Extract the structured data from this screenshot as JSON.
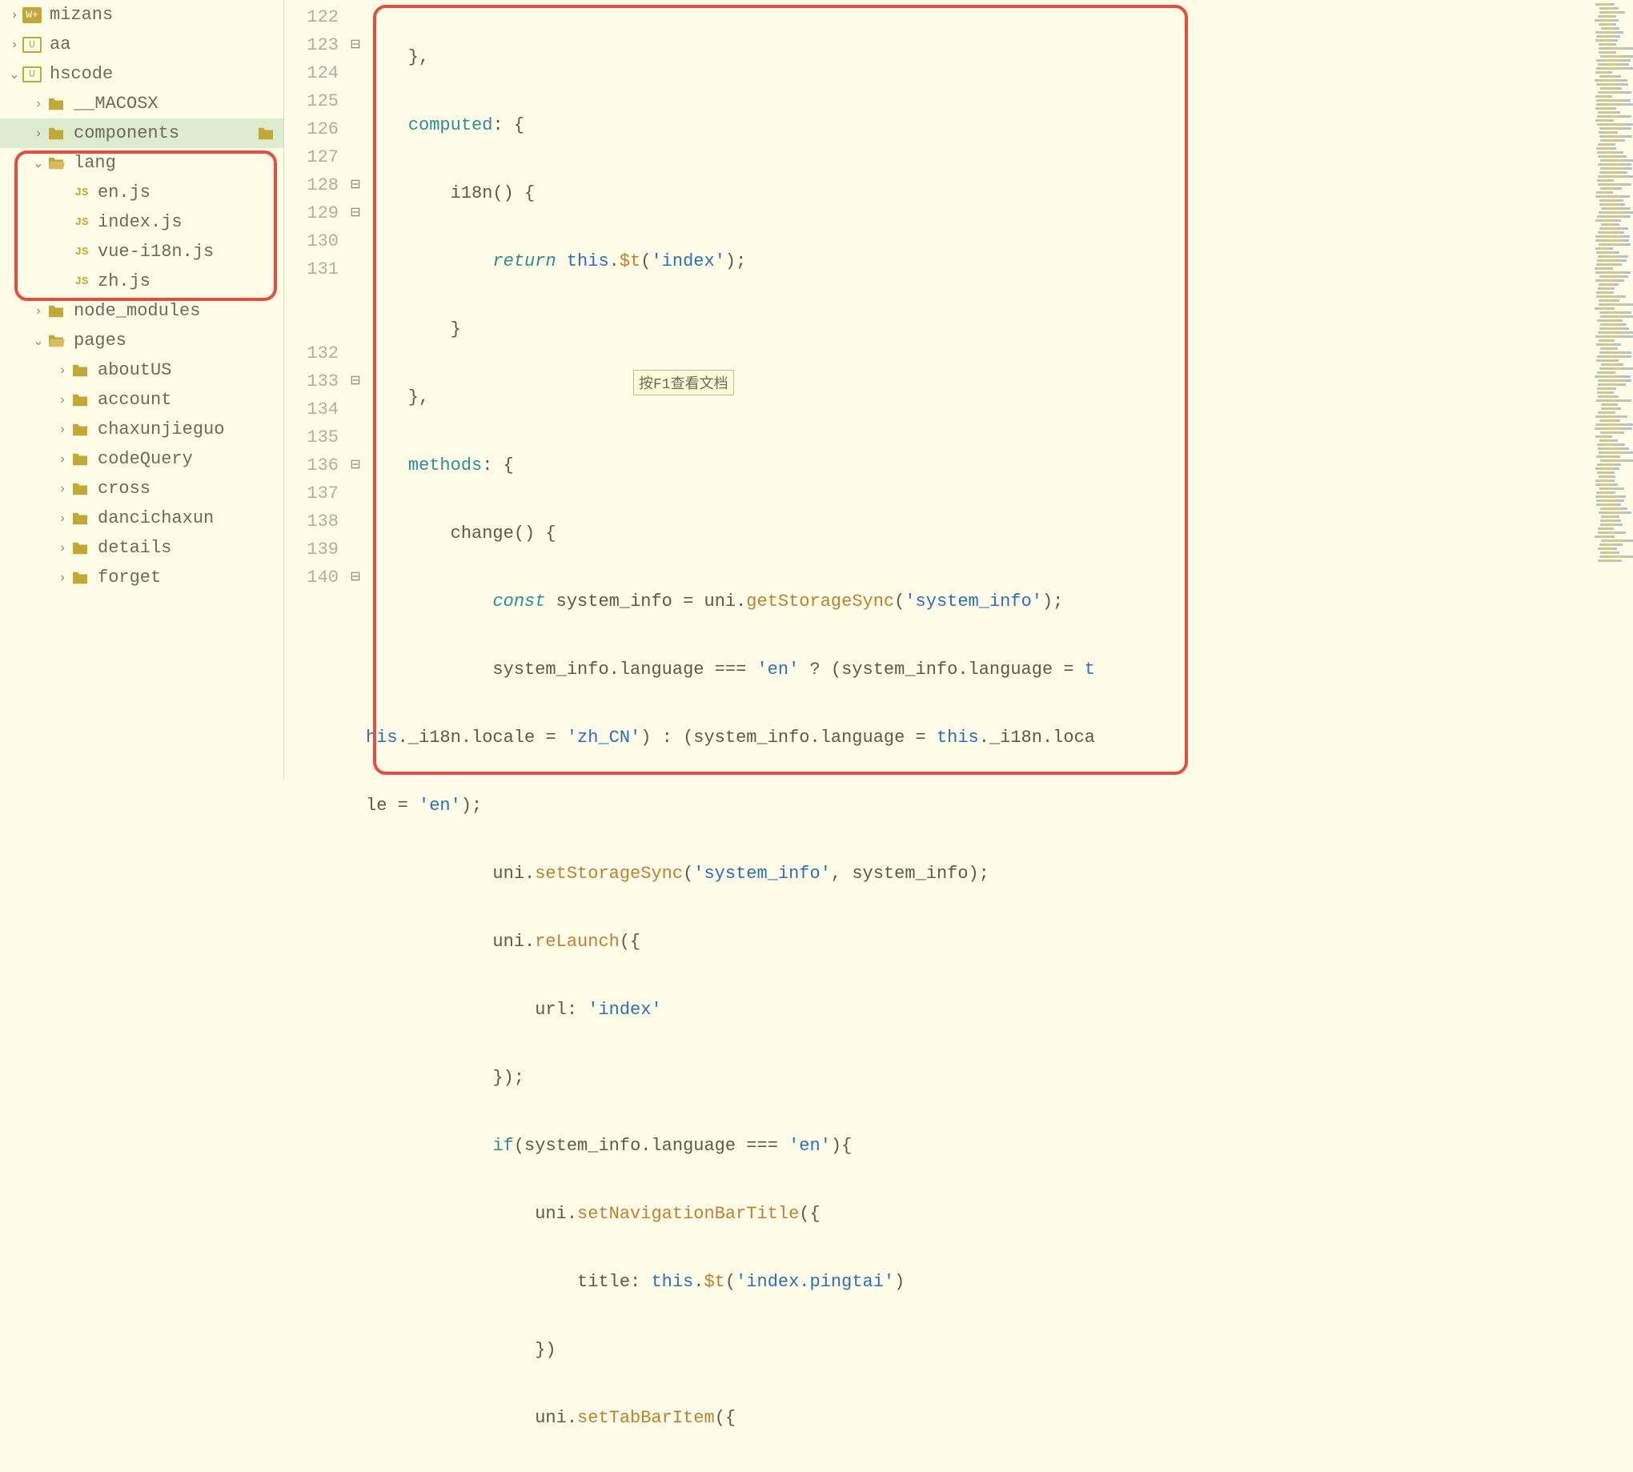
{
  "sidebar": {
    "items": [
      {
        "label": "mizans",
        "indent": 0,
        "icon": "wplus",
        "chevron": ">"
      },
      {
        "label": "aa",
        "indent": 0,
        "icon": "u",
        "chevron": ">"
      },
      {
        "label": "hscode",
        "indent": 0,
        "icon": "u",
        "chevron": "v"
      },
      {
        "label": "__MACOSX",
        "indent": 1,
        "icon": "folder",
        "chevron": ">"
      },
      {
        "label": "components",
        "indent": 1,
        "icon": "folder",
        "chevron": ">",
        "selected": true
      },
      {
        "label": "lang",
        "indent": 1,
        "icon": "folder-open",
        "chevron": "v"
      },
      {
        "label": "en.js",
        "indent": 2,
        "icon": "js"
      },
      {
        "label": "index.js",
        "indent": 2,
        "icon": "js"
      },
      {
        "label": "vue-i18n.js",
        "indent": 2,
        "icon": "js"
      },
      {
        "label": "zh.js",
        "indent": 2,
        "icon": "js"
      },
      {
        "label": "node_modules",
        "indent": 1,
        "icon": "folder",
        "chevron": ">"
      },
      {
        "label": "pages",
        "indent": 1,
        "icon": "folder-open",
        "chevron": "v"
      },
      {
        "label": "aboutUS",
        "indent": 2,
        "icon": "folder",
        "chevron": ">"
      },
      {
        "label": "account",
        "indent": 2,
        "icon": "folder",
        "chevron": ">"
      },
      {
        "label": "chaxunjieguo",
        "indent": 2,
        "icon": "folder",
        "chevron": ">"
      },
      {
        "label": "codeQuery",
        "indent": 2,
        "icon": "folder",
        "chevron": ">"
      },
      {
        "label": "cross",
        "indent": 2,
        "icon": "folder",
        "chevron": ">"
      },
      {
        "label": "dancichaxun",
        "indent": 2,
        "icon": "folder",
        "chevron": ">"
      },
      {
        "label": "details",
        "indent": 2,
        "icon": "folder",
        "chevron": ">"
      },
      {
        "label": "forget",
        "indent": 2,
        "icon": "folder",
        "chevron": ">"
      }
    ]
  },
  "gutter": {
    "lines": [
      "122",
      "123",
      "124",
      "125",
      "126",
      "127",
      "128",
      "129",
      "130",
      "131",
      "",
      "",
      "132",
      "133",
      "134",
      "135",
      "136",
      "137",
      "138",
      "139",
      "140"
    ],
    "folds": [
      "",
      "⊟",
      "",
      "",
      "",
      "",
      "⊟",
      "⊟",
      "",
      "",
      "",
      "",
      "",
      "⊟",
      "",
      "",
      "⊟",
      "",
      "",
      "",
      "⊟"
    ]
  },
  "code": {
    "l122": "    },",
    "l123_a": "    ",
    "l123_b": "computed",
    "l123_c": ": {",
    "l124": "        i18n() {",
    "l125_a": "            ",
    "l125_b": "return",
    "l125_c": " ",
    "l125_d": "this",
    "l125_e": ".",
    "l125_f": "$t",
    "l125_g": "(",
    "l125_h": "'index'",
    "l125_i": ");",
    "l126": "        }",
    "l127": "    },",
    "l128_a": "    ",
    "l128_b": "methods",
    "l128_c": ": {",
    "l129": "        change() {",
    "l130_a": "            ",
    "l130_b": "const",
    "l130_c": " system_info = uni.",
    "l130_d": "getStorageSync",
    "l130_e": "(",
    "l130_f": "'system_info'",
    "l130_g": ");",
    "l131_a": "            system_info.language === ",
    "l131_b": "'en'",
    "l131_c": " ? (system_info.language = ",
    "l131_d": "t",
    "l131w_a": "his",
    "l131w_b": "._i18n.locale = ",
    "l131w_c": "'zh_CN'",
    "l131w_d": ") : (system_info.language = ",
    "l131w_e": "this",
    "l131w_f": "._i18n.loca",
    "l131x_a": "le = ",
    "l131x_b": "'en'",
    "l131x_c": ");",
    "l132_a": "            uni.",
    "l132_b": "setStorageSync",
    "l132_c": "(",
    "l132_d": "'system_info'",
    "l132_e": ", system_info);",
    "l133_a": "            uni.",
    "l133_b": "reLaunch",
    "l133_c": "({",
    "l134_a": "                url: ",
    "l134_b": "'index'",
    "l135": "            });",
    "l136_a": "            ",
    "l136_b": "if",
    "l136_c": "(system_info.language === ",
    "l136_d": "'en'",
    "l136_e": "){",
    "l137_a": "                uni.",
    "l137_b": "setNavigationBarTitle",
    "l137_c": "({",
    "l138_a": "                    title: ",
    "l138_b": "this",
    "l138_c": ".",
    "l138_d": "$t",
    "l138_e": "(",
    "l138_f": "'index.pingtai'",
    "l138_g": ")",
    "l139": "                })",
    "l140_a": "                uni.",
    "l140_b": "setTabBarItem",
    "l140_c": "({"
  },
  "tooltip": "按F1查看文档"
}
